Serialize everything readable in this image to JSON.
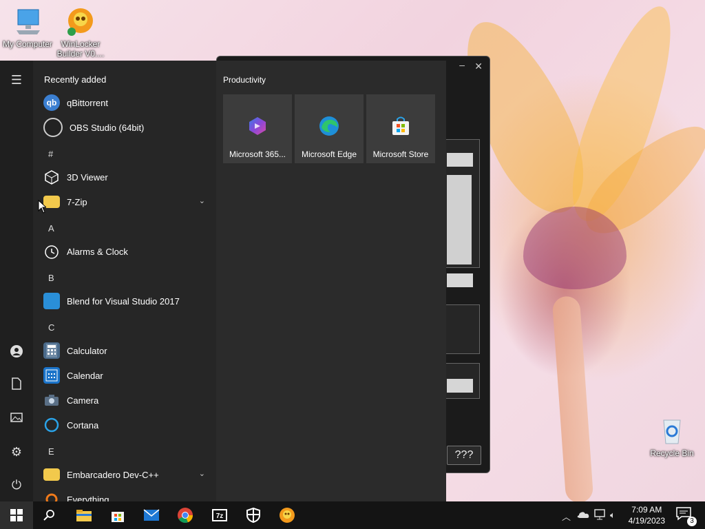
{
  "desktop": {
    "icons": [
      {
        "label": "My Computer"
      },
      {
        "label": "WinLocker Builder V0...."
      },
      {
        "label": "Recycle Bin"
      }
    ]
  },
  "background_window": {
    "button_label": "???"
  },
  "start_menu": {
    "recently_added_title": "Recently added",
    "recent": [
      {
        "label": "qBittorrent",
        "icon": "qbittorrent-icon"
      },
      {
        "label": "OBS Studio (64bit)",
        "icon": "obs-icon"
      }
    ],
    "sections": [
      {
        "letter": "#",
        "items": [
          {
            "label": "3D Viewer",
            "icon": "cube-icon"
          },
          {
            "label": "7-Zip",
            "icon": "folder-icon",
            "expandable": true
          }
        ]
      },
      {
        "letter": "A",
        "items": [
          {
            "label": "Alarms & Clock",
            "icon": "clock-icon"
          }
        ]
      },
      {
        "letter": "B",
        "items": [
          {
            "label": "Blend for Visual Studio 2017",
            "icon": "blend-icon"
          }
        ]
      },
      {
        "letter": "C",
        "items": [
          {
            "label": "Calculator",
            "icon": "calculator-icon"
          },
          {
            "label": "Calendar",
            "icon": "calendar-icon"
          },
          {
            "label": "Camera",
            "icon": "camera-icon"
          },
          {
            "label": "Cortana",
            "icon": "cortana-icon"
          }
        ]
      },
      {
        "letter": "E",
        "items": [
          {
            "label": "Embarcadero Dev-C++",
            "icon": "folder-icon",
            "expandable": true
          },
          {
            "label": "Everything",
            "icon": "everything-icon"
          }
        ]
      }
    ],
    "tile_group": "Productivity",
    "tiles": [
      {
        "label": "Microsoft 365...",
        "icon": "microsoft-365-icon"
      },
      {
        "label": "Microsoft Edge",
        "icon": "edge-icon"
      },
      {
        "label": "Microsoft Store",
        "icon": "store-icon"
      }
    ]
  },
  "taskbar": {
    "time": "7:09 AM",
    "date": "4/19/2023",
    "notification_count": "3"
  }
}
